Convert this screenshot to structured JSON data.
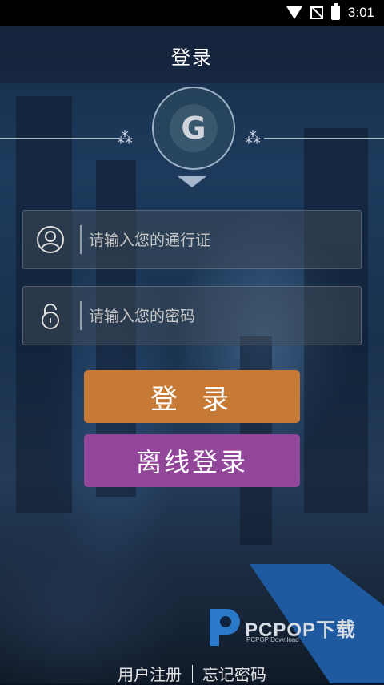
{
  "status_bar": {
    "time": "3:01"
  },
  "header": {
    "title": "登录"
  },
  "logo": {
    "letter": "G"
  },
  "form": {
    "username_placeholder": "请输入您的通行证",
    "username_value": "",
    "password_placeholder": "请输入您的密码",
    "password_value": ""
  },
  "buttons": {
    "login_label": "登录",
    "offline_login_label": "离线登录"
  },
  "footer": {
    "register_label": "用户注册",
    "forgot_password_label": "忘记密码"
  },
  "watermark": {
    "brand": "PCPOP下载",
    "sub": "PCPOP Download"
  },
  "colors": {
    "login_button": "#c77a36",
    "offline_button": "#91469a",
    "watermark_blue": "#1f5aa0"
  }
}
